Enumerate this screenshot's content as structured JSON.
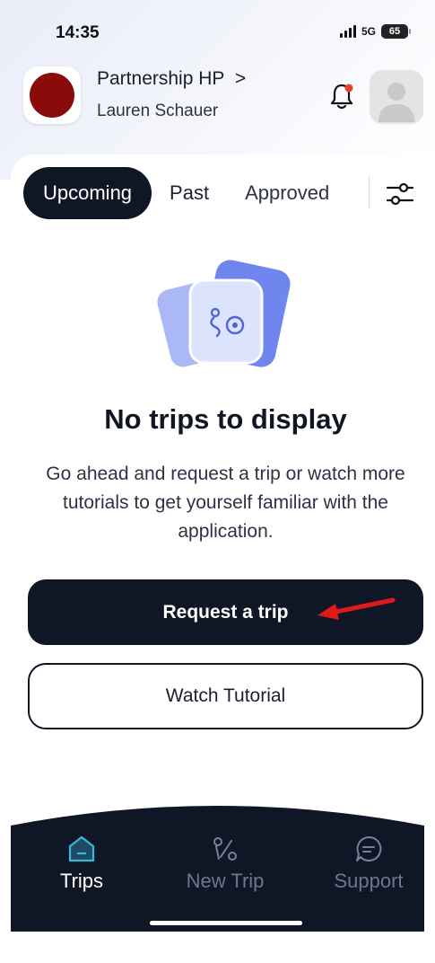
{
  "status_bar": {
    "time": "14:35",
    "network": "5G",
    "battery": "65"
  },
  "header": {
    "org_name": "Partnership HP",
    "org_chevron": ">",
    "user_name": "Lauren Schauer"
  },
  "tabs": {
    "upcoming": "Upcoming",
    "past": "Past",
    "approved": "Approved"
  },
  "empty_state": {
    "title": "No trips to display",
    "description": "Go ahead and request a trip or watch more tutorials to get yourself familiar with the application."
  },
  "actions": {
    "request_trip": "Request a trip",
    "watch_tutorial": "Watch Tutorial"
  },
  "bottom_nav": {
    "trips": "Trips",
    "new_trip": "New Trip",
    "support": "Support"
  },
  "colors": {
    "primary_dark": "#0f1626",
    "accent_teal": "#3bb8d6",
    "org_logo_red": "#8b0a0a",
    "notification_dot": "#e8412c",
    "annotation_arrow": "#e11919",
    "illustration_blue": "#6f86ee"
  },
  "icons": {
    "bell": "bell-icon",
    "filter": "sliders-icon",
    "trips": "home-icon",
    "new_trip": "route-icon",
    "support": "chat-bubble-icon"
  }
}
